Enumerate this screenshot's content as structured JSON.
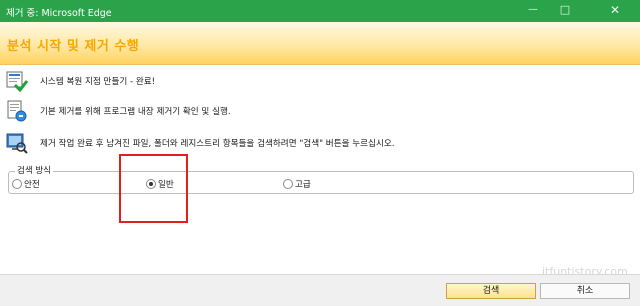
{
  "window": {
    "title": "제거 중: Microsoft Edge",
    "controls": {
      "minimize": "—",
      "maximize": "□",
      "close": "✕"
    }
  },
  "banner": {
    "title": "분석 시작 및 제거 수행"
  },
  "steps": [
    {
      "icon": "restore-point-icon",
      "text": "시스템 복원 지점 만들기 - 완료!"
    },
    {
      "icon": "uninstall-program-icon",
      "text": "기본 제거를 위해 프로그램 내장 제거기 확인 및 실행."
    },
    {
      "icon": "scan-leftovers-icon",
      "text": "제거 작업 완료 후 남겨진 파일, 폴더와 레지스트리 항목들을 검색하려면 \"검색\" 버튼을 누르십시오."
    }
  ],
  "scan_mode": {
    "legend": "검색 방식",
    "options": [
      {
        "label": "안전",
        "selected": false
      },
      {
        "label": "일반",
        "selected": true
      },
      {
        "label": "고급",
        "selected": false
      }
    ]
  },
  "footer": {
    "search_label": "검색",
    "cancel_label": "취소"
  },
  "watermark": "itfuntistory.com"
}
